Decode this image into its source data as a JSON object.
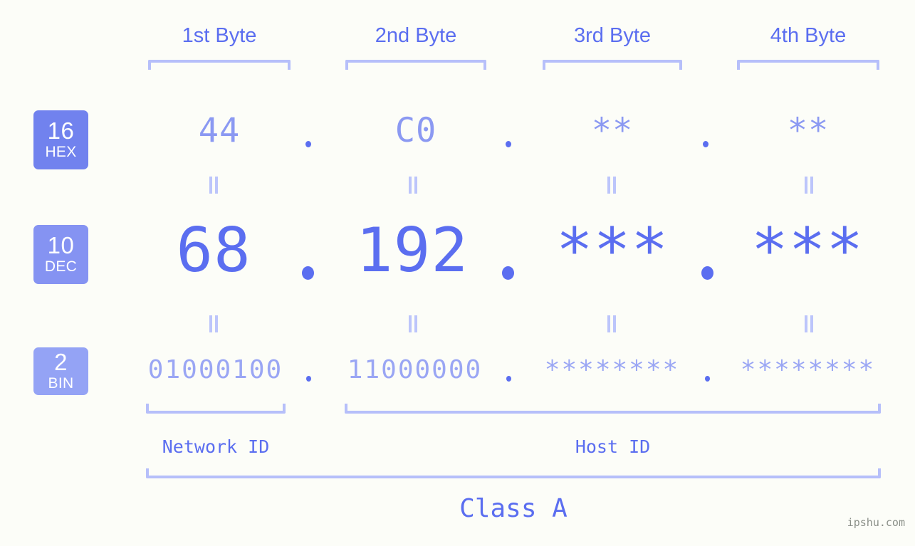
{
  "meta": {
    "watermark": "ipshu.com",
    "background_color": "#fcfdf8",
    "accent_color": "#5b6ef0",
    "accent_light_color": "#b6bffa"
  },
  "byte_headers": [
    {
      "label": "1st Byte"
    },
    {
      "label": "2nd Byte"
    },
    {
      "label": "3rd Byte"
    },
    {
      "label": "4th Byte"
    }
  ],
  "separators": {
    "dot": ".",
    "equals": "="
  },
  "rows": [
    {
      "id": "hex",
      "badge_number": "16",
      "badge_name": "HEX",
      "badge_color": "#7182ee",
      "values": [
        "44",
        "C0",
        "**",
        "**"
      ]
    },
    {
      "id": "dec",
      "badge_number": "10",
      "badge_name": "DEC",
      "badge_color": "#8593f2",
      "values": [
        "68",
        "192",
        "***",
        "***"
      ]
    },
    {
      "id": "bin",
      "badge_number": "2",
      "badge_name": "BIN",
      "badge_color": "#94a3f5",
      "values": [
        "01000100",
        "11000000",
        "********",
        "********"
      ]
    }
  ],
  "id_sections": [
    {
      "label": "Network ID"
    },
    {
      "label": "Host ID"
    }
  ],
  "class_section": {
    "label": "Class A"
  }
}
